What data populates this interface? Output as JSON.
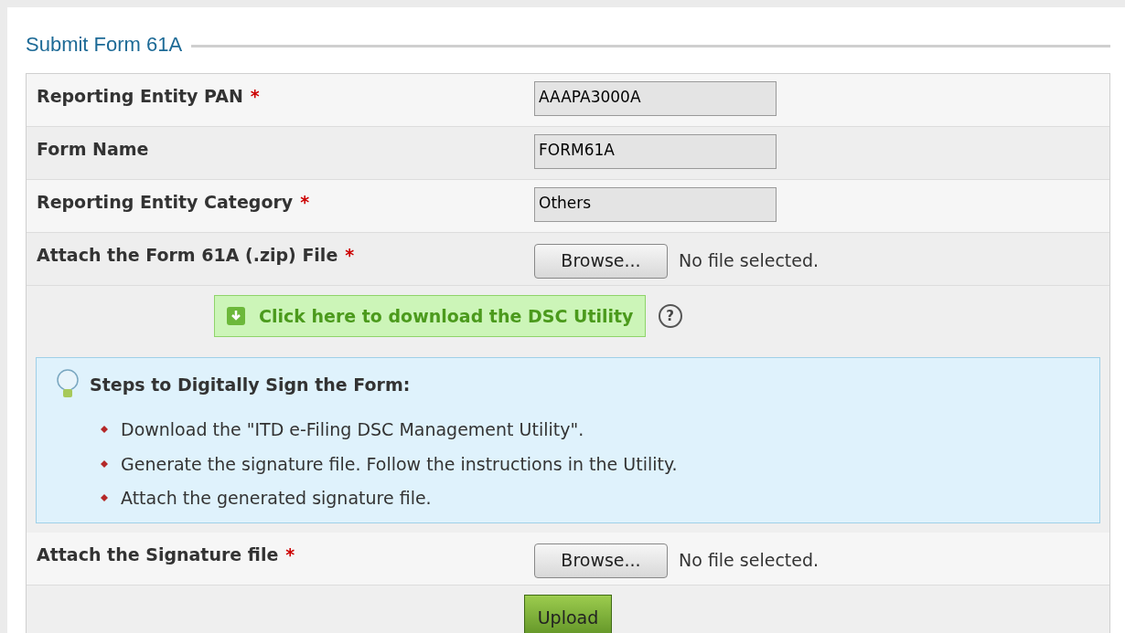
{
  "legend": "Submit Form 61A",
  "rows": [
    {
      "kind": "text",
      "label": "Reporting Entity PAN",
      "required_mark": "*",
      "value": "AAAPA3000A"
    },
    {
      "kind": "text",
      "label": "Form Name",
      "value": "FORM61A"
    },
    {
      "kind": "text",
      "label": "Reporting Entity Category",
      "required_mark": "*",
      "value": "Others"
    },
    {
      "kind": "file",
      "label": "Attach the Form 61A (.zip) File",
      "required_mark": "*",
      "button": "Browse...",
      "status": "No file selected."
    }
  ],
  "download": {
    "label": "Click here to download the DSC Utility",
    "help": "?"
  },
  "steps": {
    "title": "Steps to Digitally Sign the Form:",
    "items": [
      "Download the \"ITD e-Filing DSC Management Utility\".",
      "Generate the signature file. Follow the instructions in the Utility.",
      "Attach the generated signature file."
    ]
  },
  "signature_row": {
    "kind": "file",
    "label": "Attach the Signature file",
    "required_mark": "*",
    "button": "Browse...",
    "status": "No file selected."
  },
  "submit": "Upload"
}
